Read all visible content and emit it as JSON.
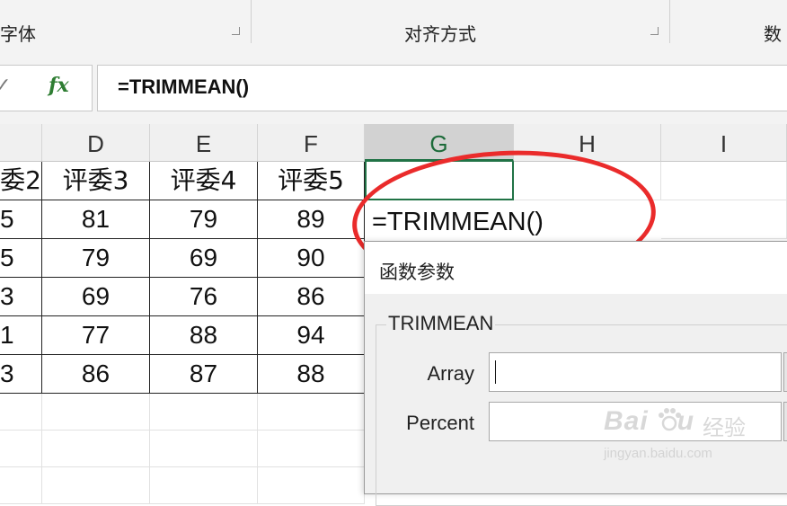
{
  "ribbon": {
    "group_font": "字体",
    "group_alignment": "对齐方式",
    "group_number": "数"
  },
  "formula_bar": {
    "enter_icon": "check-icon",
    "fx_label": "fx",
    "formula": "=TRIMMEAN()"
  },
  "columns": [
    "D",
    "E",
    "F",
    "G",
    "H",
    "I"
  ],
  "selected_column": "G",
  "sheet": {
    "partial_col_c": [
      "委2",
      "5",
      "5",
      "3",
      "1",
      "3"
    ],
    "headers": [
      "评委3",
      "评委4",
      "评委5"
    ],
    "rows": [
      [
        "81",
        "79",
        "89"
      ],
      [
        "79",
        "69",
        "90"
      ],
      [
        "69",
        "76",
        "86"
      ],
      [
        "77",
        "88",
        "94"
      ],
      [
        "86",
        "87",
        "88"
      ]
    ],
    "editing_text": "=TRIMMEAN()"
  },
  "dialog": {
    "title": "函数参数",
    "function_name": "TRIMMEAN",
    "params": [
      {
        "label": "Array",
        "value": ""
      },
      {
        "label": "Percent",
        "value": ""
      }
    ]
  },
  "watermark": {
    "logo": "Bai",
    "logo_tail": "u",
    "name": "经验",
    "url": "jingyan.baidu.com"
  },
  "colors": {
    "accent": "#217346",
    "highlight": "#ea2b2b"
  }
}
